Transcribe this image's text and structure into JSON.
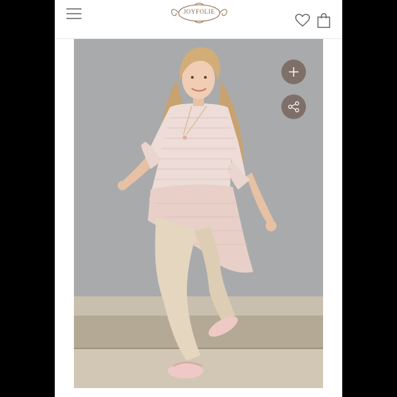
{
  "brand": {
    "name": "JOYFOLIE",
    "accent_color": "#8a6a4a"
  },
  "header": {
    "menu_icon": "hamburger-menu-icon",
    "wishlist_icon": "heart-icon",
    "cart_icon": "shopping-bag-icon"
  },
  "product_image": {
    "actions": [
      {
        "icon": "plus-icon"
      },
      {
        "icon": "share-icon"
      }
    ],
    "action_button_color": "#7e7068"
  }
}
